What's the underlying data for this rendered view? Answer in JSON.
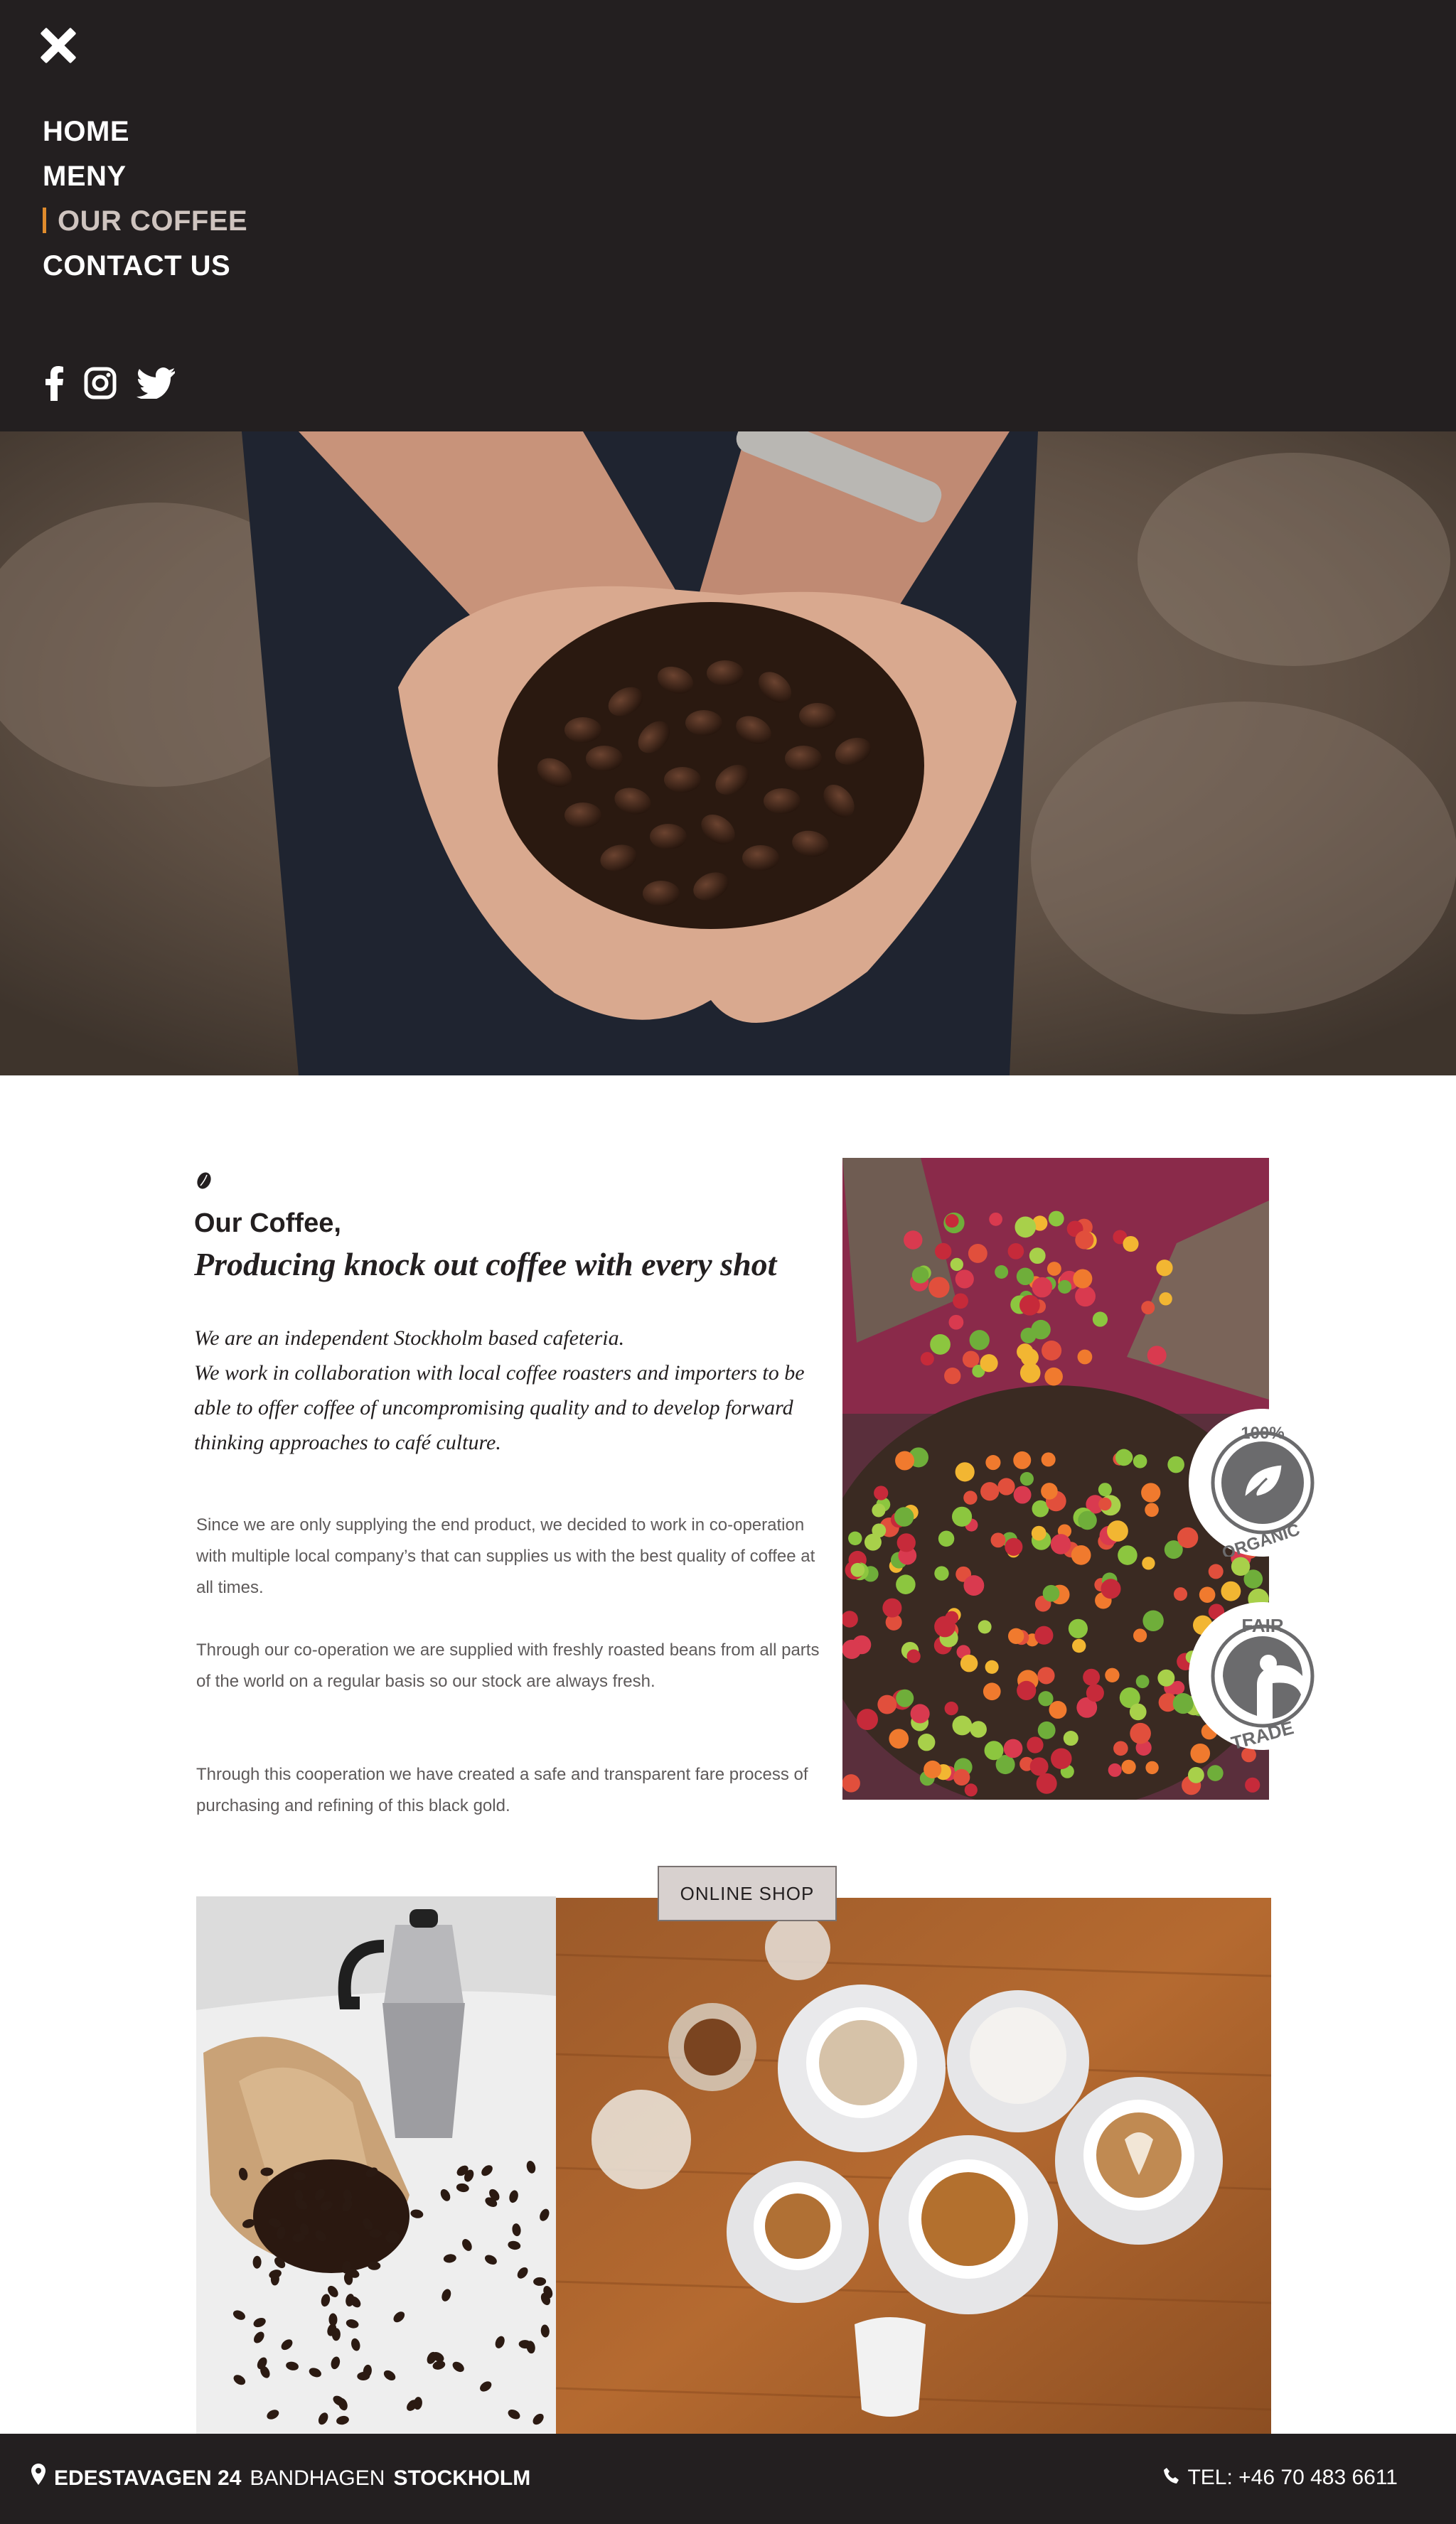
{
  "nav": {
    "close_label": "Close menu",
    "items": [
      {
        "label": "HOME",
        "active": false
      },
      {
        "label": "MENY",
        "active": false
      },
      {
        "label": "OUR COFFEE",
        "active": true
      },
      {
        "label": "CONTACT US",
        "active": false
      }
    ],
    "social": [
      "facebook-icon",
      "instagram-icon",
      "twitter-icon"
    ],
    "accent_color": "#e08b2c",
    "background": "#231f20"
  },
  "intro": {
    "title": "Our Coffee,",
    "subtitle": "Producing knock out coffee with every shot",
    "lead_line1": "We are an independent Stockholm based cafeteria.",
    "lead_line2": "We work in collaboration with local coffee roasters and importers to be able to offer coffee of uncompromising quality and to develop forward thinking approaches to café culture.",
    "paragraphs": [
      "Since we are only supplying the end product, we decided to work in co-operation with multiple local company’s that can supplies us with the best quality of coffee at all times.",
      "Through our co-operation we are supplied with freshly roasted beans from all parts of the world on a regular basis so our stock are always fresh.",
      "Through this cooperation we have created a safe and transparent fare process of purchasing and refining of this black gold."
    ]
  },
  "badges": {
    "organic_top": "100%",
    "organic_bottom": "ORGANIC",
    "fair_top": "FAIR",
    "fair_bottom": "TRADE",
    "color": "#6b6b6d"
  },
  "shop_button": "ONLINE SHOP",
  "footer": {
    "street": "EDESTAVAGEN 24",
    "area": "BANDHAGEN",
    "city": "STOCKHOLM",
    "tel": "TEL: +46 70 483 6611"
  }
}
